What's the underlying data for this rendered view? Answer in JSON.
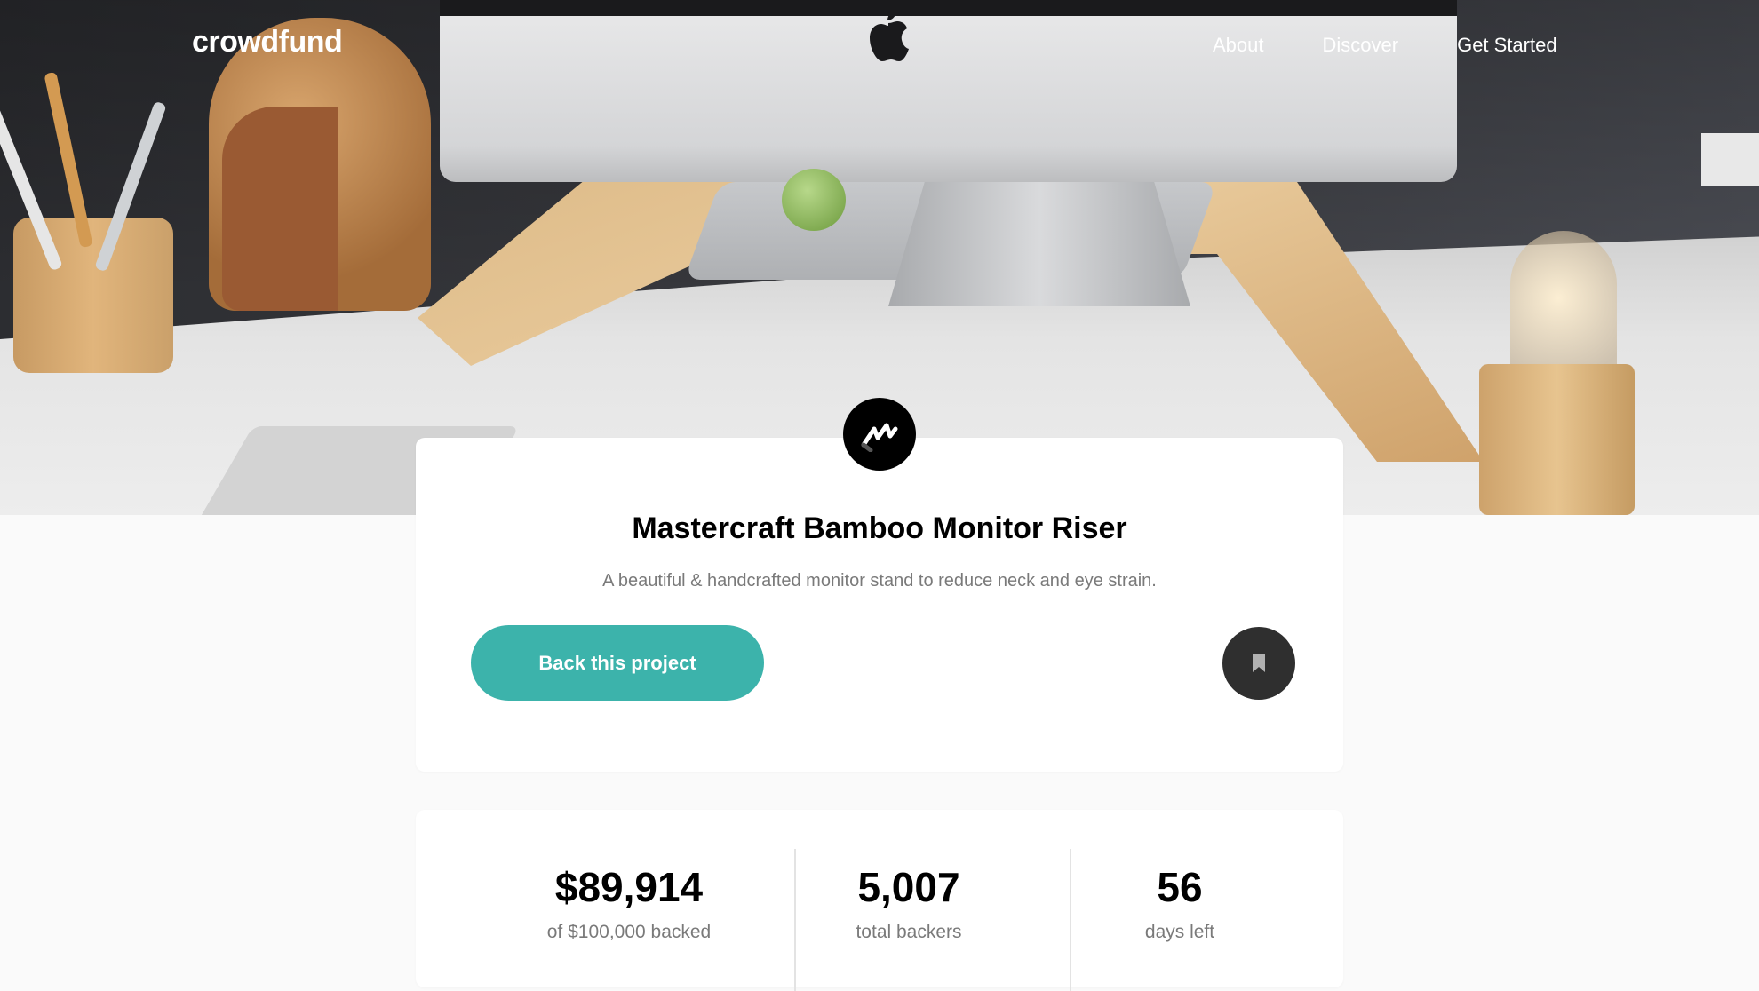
{
  "nav": {
    "logo": "crowdfund",
    "links": [
      "About",
      "Discover",
      "Get Started"
    ]
  },
  "project": {
    "title": "Mastercraft Bamboo Monitor Riser",
    "description": "A beautiful & handcrafted monitor stand to reduce neck and eye strain.",
    "back_button": "Back this project"
  },
  "stats": [
    {
      "value": "$89,914",
      "label": "of $100,000 backed"
    },
    {
      "value": "5,007",
      "label": "total backers"
    },
    {
      "value": "56",
      "label": "days left"
    }
  ],
  "colors": {
    "accent": "#3cb3ab",
    "dark": "#2f2f2f",
    "muted_text": "#7a7a7a",
    "page_bg": "#fafafa"
  },
  "icons": {
    "project_logo": "mastercraft-logo-icon",
    "bookmark": "bookmark-icon"
  }
}
